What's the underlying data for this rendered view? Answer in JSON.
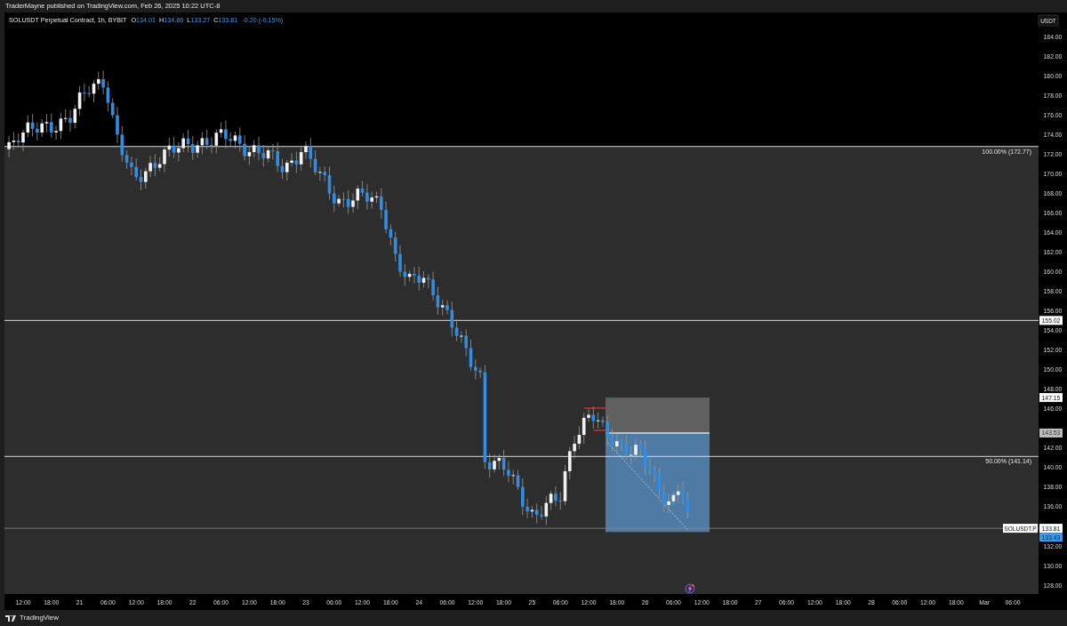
{
  "header": {
    "text": "TraderMayne published on TradingView.com, Feb 26, 2025 10:22 UTC-8"
  },
  "legend": {
    "symbol": "SOLUSDT Perpetual Contract, 1h, BYBIT",
    "ohlc": [
      {
        "key": "O",
        "value": "134.01"
      },
      {
        "key": "H",
        "value": "134.86"
      },
      {
        "key": "L",
        "value": "133.27"
      },
      {
        "key": "C",
        "value": "133.81"
      }
    ],
    "change": "-0.20 (-0.15%)"
  },
  "currency": "USDT",
  "y_axis": [
    "184.00",
    "182.00",
    "180.00",
    "178.00",
    "176.00",
    "174.00",
    "172.00",
    "170.00",
    "168.00",
    "166.00",
    "164.00",
    "162.00",
    "160.00",
    "158.00",
    "156.00",
    "154.00",
    "152.00",
    "150.00",
    "148.00",
    "146.00",
    "142.00",
    "140.00",
    "138.00",
    "136.00",
    "132.00",
    "130.00",
    "128.00"
  ],
  "level_lines": [
    {
      "label": "100.00% (172.77)"
    },
    {
      "label": "50.00% (141.14)"
    }
  ],
  "price_tags": [
    {
      "text": "155.02",
      "kind": "line"
    },
    {
      "text": "147.15",
      "kind": "line"
    },
    {
      "text": "143.53",
      "kind": "shade"
    },
    {
      "text": "133.81",
      "kind": "line"
    },
    {
      "text": "133.43",
      "kind": "accent"
    }
  ],
  "symbol_tag": "SOLUSDT.P",
  "time_axis": [
    "12:00",
    "18:00",
    "21",
    "06:00",
    "12:00",
    "18:00",
    "22",
    "06:00",
    "12:00",
    "18:00",
    "23",
    "06:00",
    "12:00",
    "18:00",
    "24",
    "06:00",
    "12:00",
    "18:00",
    "25",
    "06:00",
    "12:00",
    "18:00",
    "26",
    "06:00",
    "12:00",
    "18:00",
    "27",
    "06:00",
    "12:00",
    "18:00",
    "28",
    "06:00",
    "12:00",
    "18:00",
    "Mar",
    "06:00"
  ],
  "footer": {
    "logo": "TradingView"
  }
}
